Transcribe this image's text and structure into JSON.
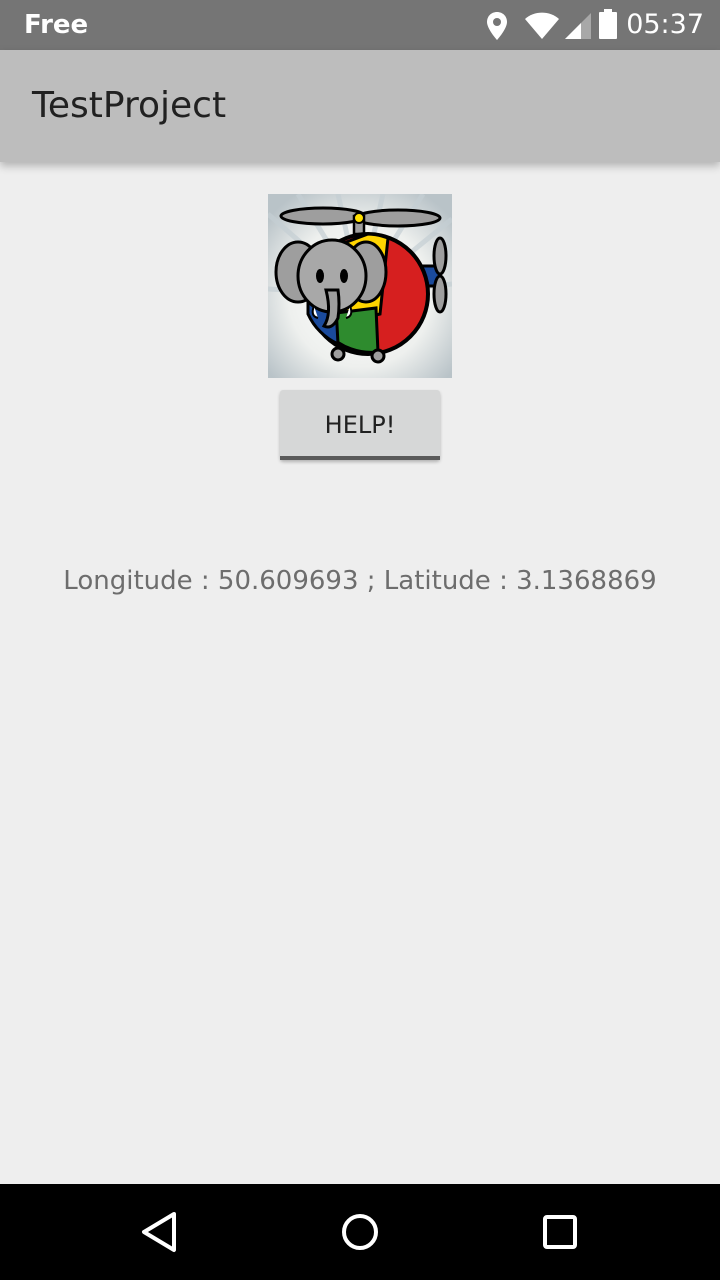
{
  "status_bar": {
    "carrier": "Free",
    "time": "05:37",
    "icons": [
      "location-icon",
      "wifi-icon",
      "cellular-signal-icon",
      "battery-icon"
    ]
  },
  "app_bar": {
    "title": "TestProject"
  },
  "main": {
    "logo_icon": "elephant-helicopter-logo",
    "help_button_label": "HELP!",
    "coordinates_text": "Longitude : 50.609693 ; Latitude : 3.1368869"
  },
  "nav_bar": {
    "icons": [
      "back-icon",
      "home-icon",
      "recents-icon"
    ]
  },
  "colors": {
    "status_bar": "#757575",
    "app_bar": "#bdbdbd",
    "background": "#eeeeee",
    "button": "#d6d7d7",
    "nav_bar": "#000000"
  }
}
